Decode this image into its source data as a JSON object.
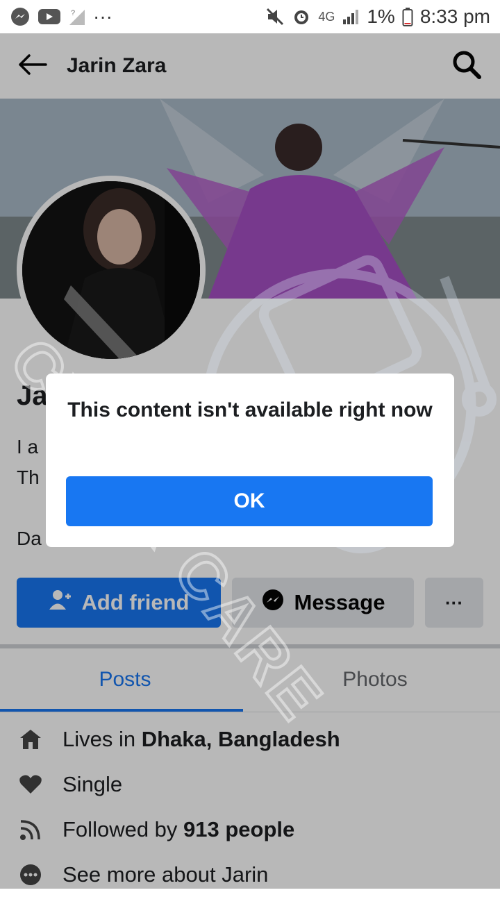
{
  "status_bar": {
    "network": "4G",
    "battery": "1%",
    "time": "8:33 pm",
    "more": "···"
  },
  "header": {
    "back_icon": "back-arrow-icon",
    "title": "Jarin Zara",
    "search_icon": "search-icon"
  },
  "profile": {
    "name_peek": "Ja",
    "bio_line1_peek": "I a",
    "bio_line2_peek": "Th",
    "bio_line3_peek": "Da"
  },
  "actions": {
    "add_friend": "Add friend",
    "message": "Message",
    "more": "···"
  },
  "tabs": [
    {
      "label": "Posts",
      "active": true
    },
    {
      "label": "Photos",
      "active": false
    }
  ],
  "info": {
    "lives_prefix": "Lives in ",
    "lives_place": "Dhaka, Bangladesh",
    "relationship": "Single",
    "followed_prefix": "Followed by ",
    "followed_count": "913 people",
    "see_more": "See more about Jarin"
  },
  "dialog": {
    "message": "This content isn't available right now",
    "ok": "OK"
  },
  "watermark": {
    "text": "CYBER CARE"
  },
  "colors": {
    "accent": "#1877f2",
    "secondary_button": "#e4e6eb"
  }
}
